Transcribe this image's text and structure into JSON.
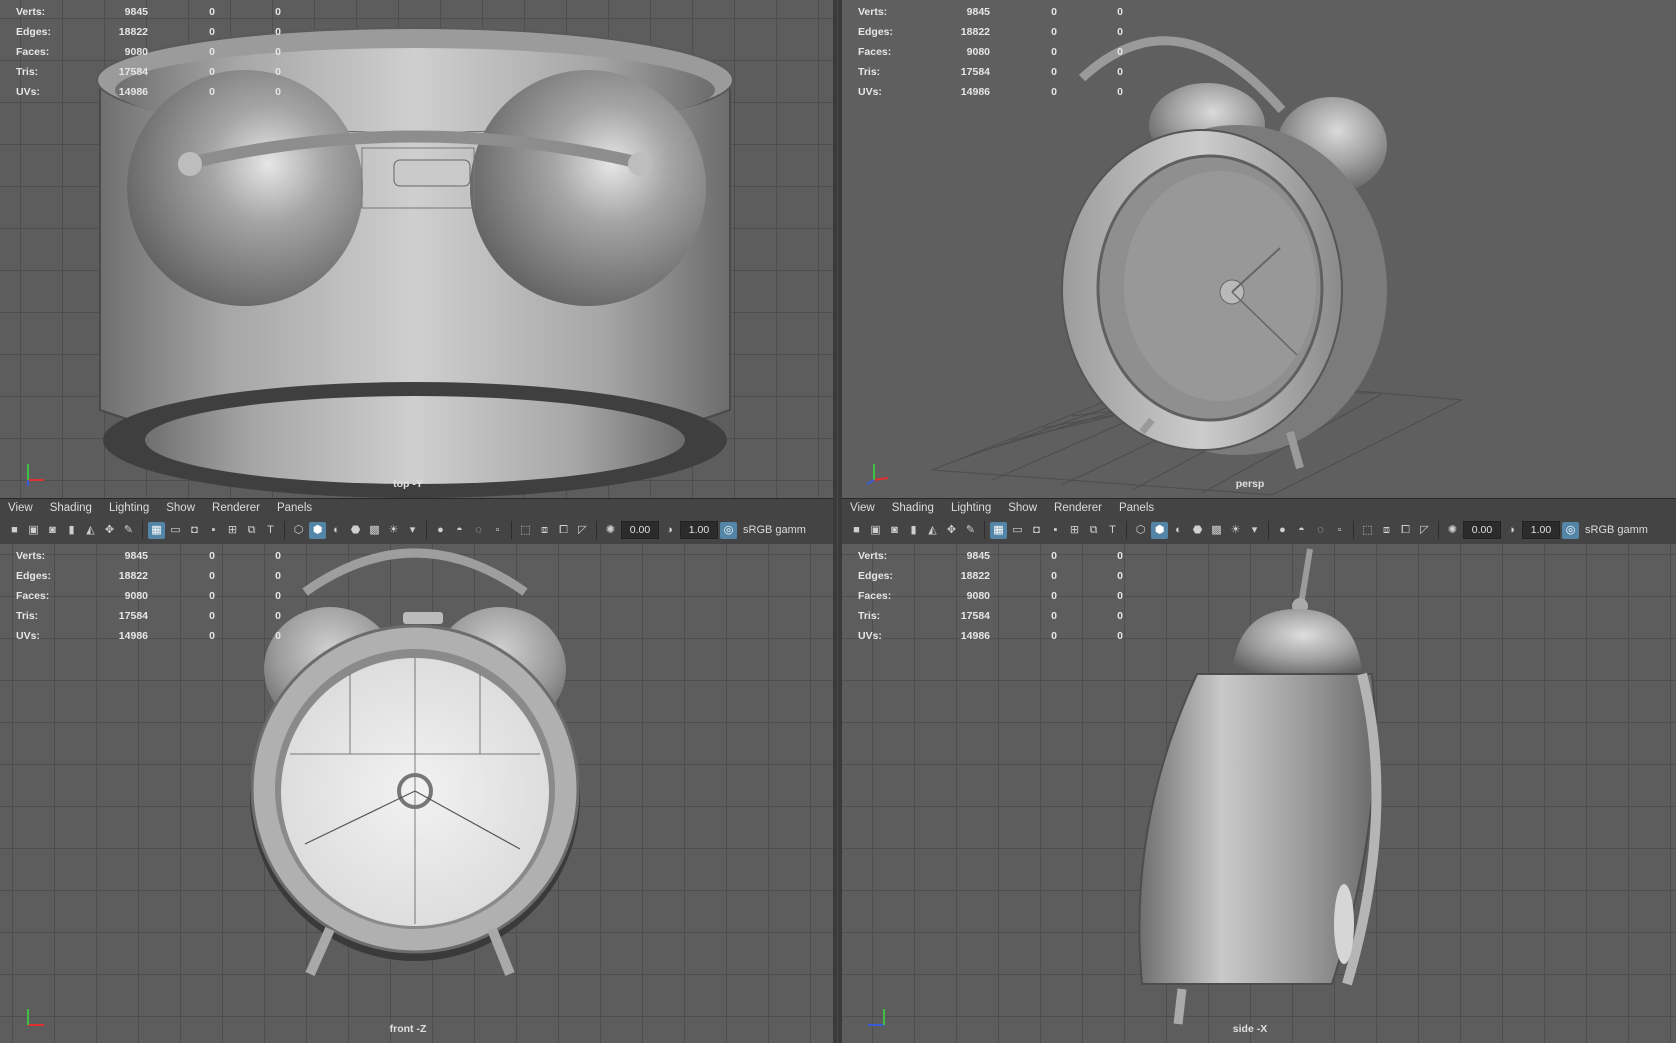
{
  "stats": {
    "rows": [
      {
        "label": "Verts:",
        "a": "9845",
        "b": "0",
        "c": "0"
      },
      {
        "label": "Edges:",
        "a": "18822",
        "b": "0",
        "c": "0"
      },
      {
        "label": "Faces:",
        "a": "9080",
        "b": "0",
        "c": "0"
      },
      {
        "label": "Tris:",
        "a": "17584",
        "b": "0",
        "c": "0"
      },
      {
        "label": "UVs:",
        "a": "14986",
        "b": "0",
        "c": "0"
      }
    ]
  },
  "viewports": {
    "top": {
      "camera": "top -Y"
    },
    "persp": {
      "camera": "persp"
    },
    "front": {
      "camera": "front -Z"
    },
    "side": {
      "camera": "side -X"
    }
  },
  "panel_menu": [
    "View",
    "Shading",
    "Lighting",
    "Show",
    "Renderer",
    "Panels"
  ],
  "toolbar": {
    "exposure": "0.00",
    "gamma": "1.00",
    "color_space": "sRGB gamm"
  },
  "colors": {
    "viewport_bg": "#5d5d5d",
    "grid": "#4e4e4e",
    "model": "#a8a8a8",
    "active_tool": "#5285a6",
    "axis_x": "#e03030",
    "axis_y": "#40c040",
    "axis_z": "#3a5ad8"
  }
}
